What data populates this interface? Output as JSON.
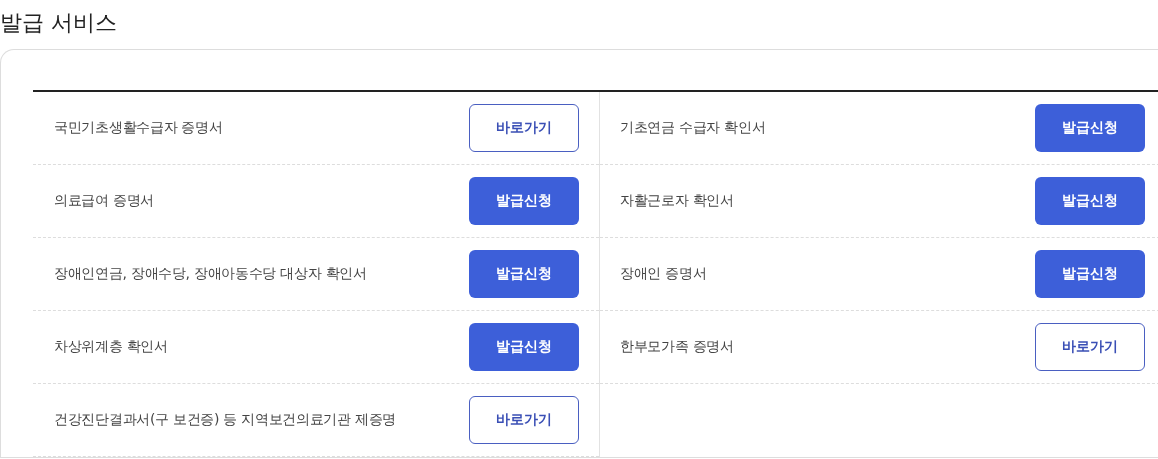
{
  "title": "발급 서비스",
  "columns": [
    {
      "items": [
        {
          "name": "국민기초생활수급자 증명서",
          "button": {
            "label": "바로가기",
            "kind": "outline"
          }
        },
        {
          "name": "의료급여 증명서",
          "button": {
            "label": "발급신청",
            "kind": "primary"
          }
        },
        {
          "name": "장애인연금, 장애수당, 장애아동수당 대상자 확인서",
          "button": {
            "label": "발급신청",
            "kind": "primary"
          }
        },
        {
          "name": "차상위계층 확인서",
          "button": {
            "label": "발급신청",
            "kind": "primary"
          }
        },
        {
          "name": "건강진단결과서(구 보건증) 등 지역보건의료기관 제증명",
          "button": {
            "label": "바로가기",
            "kind": "outline"
          }
        }
      ]
    },
    {
      "items": [
        {
          "name": "기초연금 수급자 확인서",
          "button": {
            "label": "발급신청",
            "kind": "primary"
          }
        },
        {
          "name": "자활근로자 확인서",
          "button": {
            "label": "발급신청",
            "kind": "primary"
          }
        },
        {
          "name": "장애인 증명서",
          "button": {
            "label": "발급신청",
            "kind": "primary"
          }
        },
        {
          "name": "한부모가족 증명서",
          "button": {
            "label": "바로가기",
            "kind": "outline"
          }
        }
      ]
    }
  ]
}
